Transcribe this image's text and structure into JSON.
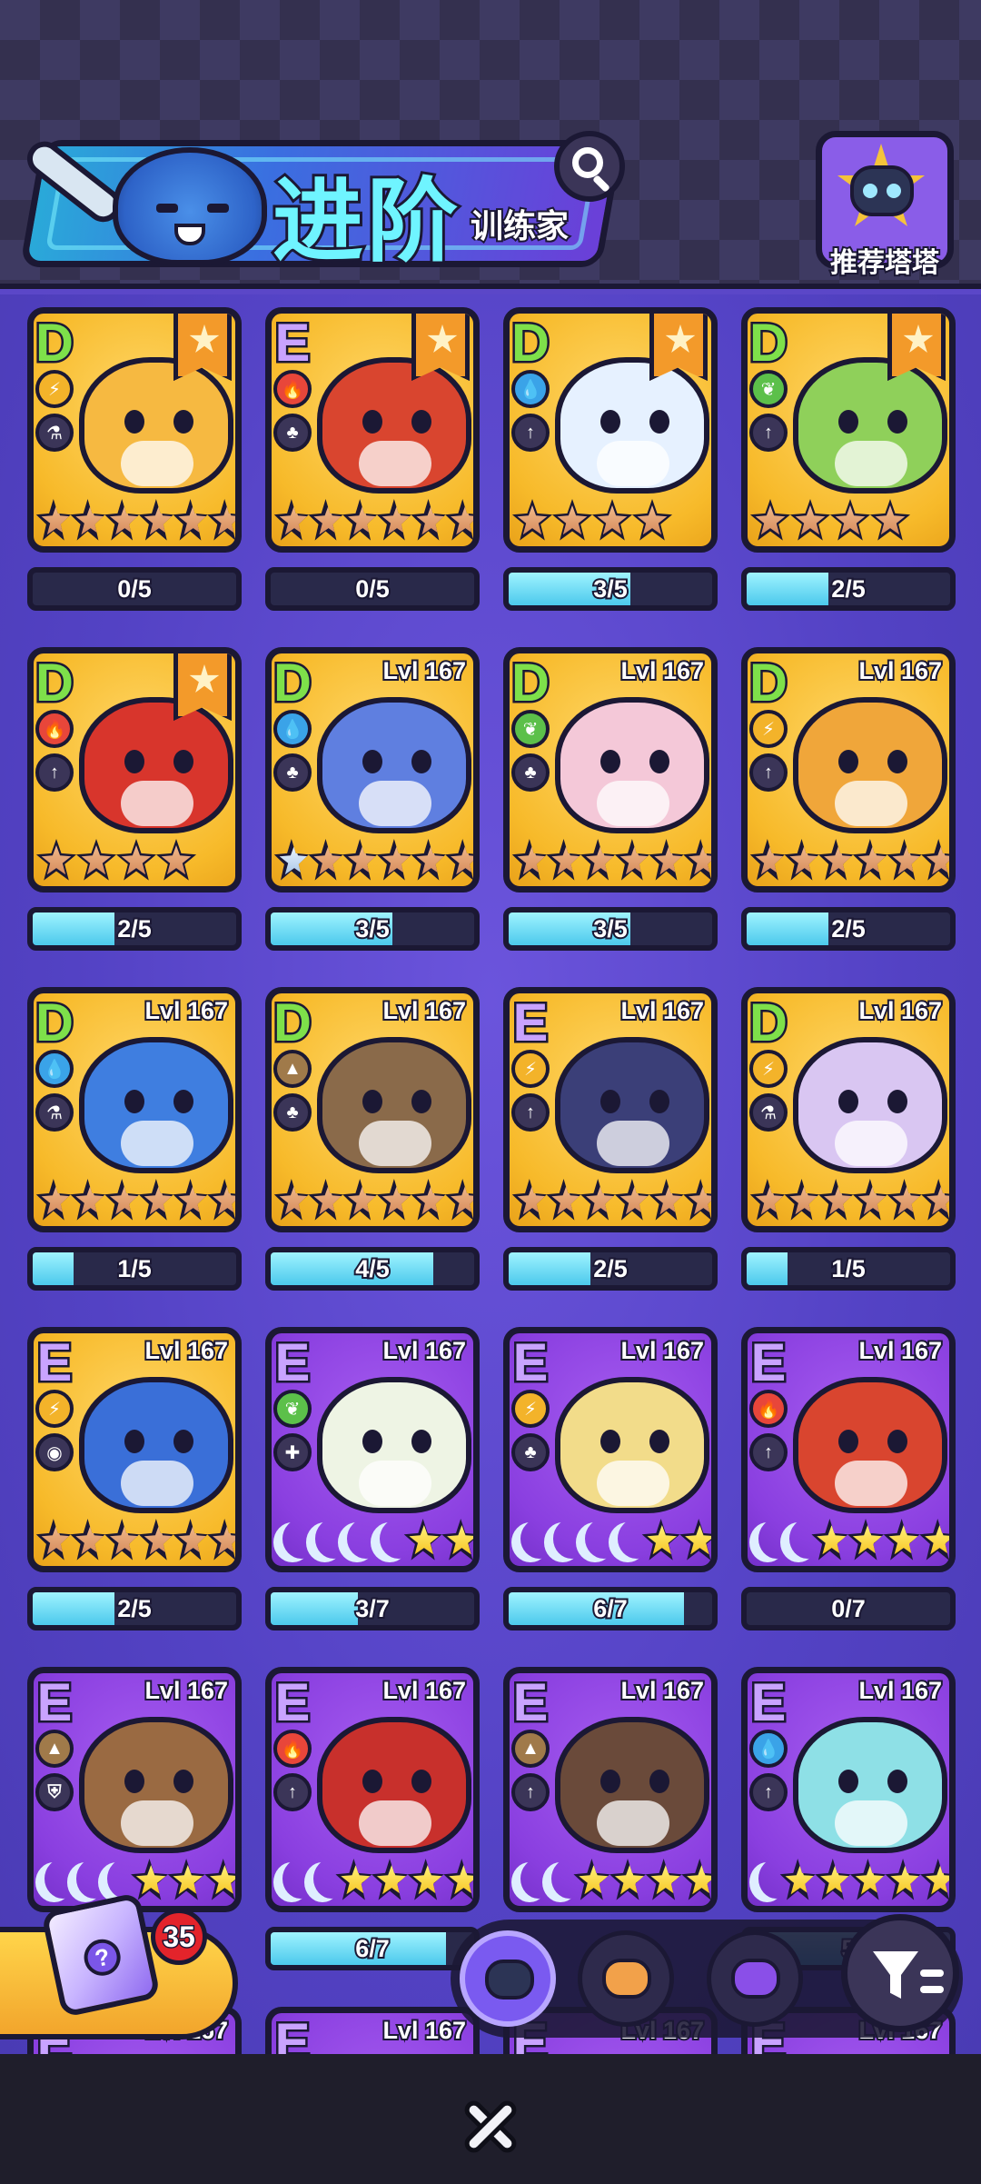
{
  "header": {
    "title": "进阶",
    "subtitle": "训练家",
    "search_icon": "search-icon",
    "recommend_label": "推荐塔塔"
  },
  "cards": [
    {
      "rank": "D",
      "bg": "yellow",
      "element": "thunder",
      "elem_color": "#f3b32a",
      "role": "flask",
      "favorite": true,
      "level": "",
      "creature_color": "#f6b941",
      "stars": [
        "bronze",
        "bronze",
        "bronze",
        "bronze",
        "bronze",
        "bronze"
      ],
      "progress": "0/5",
      "fill": 0.0
    },
    {
      "rank": "E",
      "bg": "yellow",
      "element": "fire",
      "elem_color": "#e8463a",
      "role": "leaf",
      "favorite": true,
      "level": "",
      "creature_color": "#d9452f",
      "stars": [
        "bronze",
        "bronze",
        "bronze",
        "bronze",
        "bronze",
        "bronze"
      ],
      "progress": "0/5",
      "fill": 0.0
    },
    {
      "rank": "D",
      "bg": "yellow",
      "element": "water",
      "elem_color": "#3aa3e8",
      "role": "arrow",
      "favorite": true,
      "level": "",
      "creature_color": "#e6f1ff",
      "stars": [
        "bronze",
        "bronze",
        "bronze",
        "bronze"
      ],
      "progress": "3/5",
      "fill": 0.6
    },
    {
      "rank": "D",
      "bg": "yellow",
      "element": "grass",
      "elem_color": "#5cc04a",
      "role": "arrow",
      "favorite": true,
      "level": "",
      "creature_color": "#8fd05a",
      "stars": [
        "bronze",
        "bronze",
        "bronze",
        "bronze"
      ],
      "progress": "2/5",
      "fill": 0.4
    },
    {
      "rank": "D",
      "bg": "yellow",
      "element": "fire",
      "elem_color": "#e8463a",
      "role": "arrow",
      "favorite": true,
      "level": "",
      "creature_color": "#d8352c",
      "stars": [
        "bronze",
        "bronze",
        "bronze",
        "bronze"
      ],
      "progress": "2/5",
      "fill": 0.4
    },
    {
      "rank": "D",
      "bg": "yellow",
      "element": "water",
      "elem_color": "#3aa3e8",
      "role": "leaf",
      "favorite": false,
      "level": "Lvl 167",
      "creature_color": "#5f7fe0",
      "stars": [
        "silver",
        "bronze",
        "bronze",
        "bronze",
        "bronze",
        "bronze"
      ],
      "progress": "3/5",
      "fill": 0.6
    },
    {
      "rank": "D",
      "bg": "yellow",
      "element": "grass",
      "elem_color": "#5cc04a",
      "role": "leaf",
      "favorite": false,
      "level": "Lvl 167",
      "creature_color": "#f4c8d8",
      "stars": [
        "bronze",
        "bronze",
        "bronze",
        "bronze",
        "bronze",
        "bronze"
      ],
      "progress": "3/5",
      "fill": 0.6
    },
    {
      "rank": "D",
      "bg": "yellow",
      "element": "thunder",
      "elem_color": "#f3b32a",
      "role": "arrow",
      "favorite": false,
      "level": "Lvl 167",
      "creature_color": "#f0a63a",
      "stars": [
        "bronze",
        "bronze",
        "bronze",
        "bronze",
        "bronze",
        "bronze"
      ],
      "progress": "2/5",
      "fill": 0.4
    },
    {
      "rank": "D",
      "bg": "yellow",
      "element": "water",
      "elem_color": "#3aa3e8",
      "role": "flask",
      "favorite": false,
      "level": "Lvl 167",
      "creature_color": "#3f7ee0",
      "stars": [
        "bronze",
        "bronze",
        "bronze",
        "bronze",
        "bronze",
        "bronze"
      ],
      "progress": "1/5",
      "fill": 0.2
    },
    {
      "rank": "D",
      "bg": "yellow",
      "element": "rock",
      "elem_color": "#a07a4a",
      "role": "leaf",
      "favorite": false,
      "level": "Lvl 167",
      "creature_color": "#8a6a4a",
      "stars": [
        "bronze",
        "bronze",
        "bronze",
        "bronze",
        "bronze",
        "bronze"
      ],
      "progress": "4/5",
      "fill": 0.8
    },
    {
      "rank": "E",
      "bg": "yellow",
      "element": "thunder",
      "elem_color": "#f3b32a",
      "role": "arrow",
      "favorite": false,
      "level": "Lvl 167",
      "creature_color": "#3b3f78",
      "stars": [
        "bronze",
        "bronze",
        "bronze",
        "bronze",
        "bronze",
        "bronze"
      ],
      "progress": "2/5",
      "fill": 0.4
    },
    {
      "rank": "D",
      "bg": "yellow",
      "element": "thunder",
      "elem_color": "#f3b32a",
      "role": "flask",
      "favorite": false,
      "level": "Lvl 167",
      "creature_color": "#d9c6f2",
      "stars": [
        "bronze",
        "bronze",
        "bronze",
        "bronze",
        "bronze",
        "bronze"
      ],
      "progress": "1/5",
      "fill": 0.2
    },
    {
      "rank": "E",
      "bg": "yellow",
      "element": "thunder",
      "elem_color": "#f3b32a",
      "role": "eye",
      "favorite": false,
      "level": "Lvl 167",
      "creature_color": "#3a6fd8",
      "stars": [
        "bronze",
        "bronze",
        "bronze",
        "bronze",
        "bronze",
        "bronze"
      ],
      "progress": "2/5",
      "fill": 0.4
    },
    {
      "rank": "E",
      "bg": "purple",
      "element": "grass",
      "elem_color": "#5cc04a",
      "role": "cross",
      "favorite": false,
      "level": "Lvl 167",
      "creature_color": "#eef4e4",
      "stars": [
        "moon",
        "moon",
        "moon",
        "moon",
        "gold",
        "gold"
      ],
      "progress": "3/7",
      "fill": 0.43
    },
    {
      "rank": "E",
      "bg": "purple",
      "element": "thunder",
      "elem_color": "#f3b32a",
      "role": "leaf",
      "favorite": false,
      "level": "Lvl 167",
      "creature_color": "#f2dc8a",
      "stars": [
        "moon",
        "moon",
        "moon",
        "moon",
        "gold",
        "gold"
      ],
      "progress": "6/7",
      "fill": 0.86
    },
    {
      "rank": "E",
      "bg": "purple",
      "element": "fire",
      "elem_color": "#e8463a",
      "role": "arrow",
      "favorite": false,
      "level": "Lvl 167",
      "creature_color": "#d9452f",
      "stars": [
        "moon",
        "moon",
        "gold",
        "gold",
        "gold",
        "gold"
      ],
      "progress": "0/7",
      "fill": 0.0
    },
    {
      "rank": "E",
      "bg": "purple",
      "element": "rock",
      "elem_color": "#a07a4a",
      "role": "shield",
      "favorite": false,
      "level": "Lvl 167",
      "creature_color": "#9a6a42",
      "stars": [
        "moon",
        "moon",
        "moon",
        "gold",
        "gold",
        "gold"
      ],
      "progress": "",
      "fill": 0.0
    },
    {
      "rank": "E",
      "bg": "purple",
      "element": "fire",
      "elem_color": "#e8463a",
      "role": "arrow",
      "favorite": false,
      "level": "Lvl 167",
      "creature_color": "#c8302c",
      "stars": [
        "moon",
        "moon",
        "gold",
        "gold",
        "gold",
        "gold"
      ],
      "progress": "6/7",
      "fill": 0.86
    },
    {
      "rank": "E",
      "bg": "purple",
      "element": "rock",
      "elem_color": "#a07a4a",
      "role": "arrow",
      "favorite": false,
      "level": "Lvl 167",
      "creature_color": "#6a4a3a",
      "stars": [
        "moon",
        "moon",
        "gold",
        "gold",
        "gold",
        "gold"
      ],
      "progress": "",
      "fill": 0.0
    },
    {
      "rank": "E",
      "bg": "purple",
      "element": "water",
      "elem_color": "#3aa3e8",
      "role": "arrow",
      "favorite": false,
      "level": "Lvl 167",
      "creature_color": "#8ee0e6",
      "stars": [
        "moon",
        "gold",
        "gold",
        "gold",
        "gold",
        "gold"
      ],
      "progress": "5",
      "fill": 0.7
    }
  ],
  "peek_row": {
    "rank": "E",
    "level": "Lvl 167"
  },
  "bottom_dock": {
    "items": [
      "bot-tab-icon",
      "hamster-tab-icon",
      "cat-badge-tab-icon"
    ],
    "filter_icon": "filter-icon"
  },
  "chest": {
    "count": "35",
    "icon": "mystery-cube-icon"
  },
  "close_icon": "close-icon"
}
